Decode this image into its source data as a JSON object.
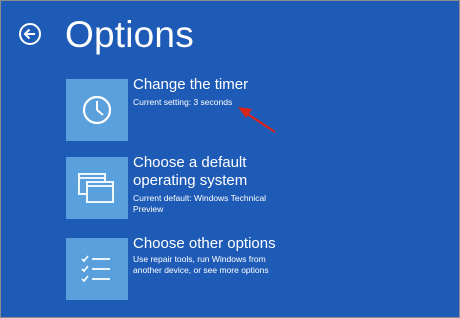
{
  "page": {
    "title": "Options",
    "back_icon": "back-arrow-icon"
  },
  "options": [
    {
      "title": "Change the timer",
      "subtitle": "Current setting: 3 seconds",
      "icon": "clock-icon"
    },
    {
      "title": "Choose a default operating system",
      "subtitle": "Current default: Windows Technical Preview",
      "icon": "windows-stack-icon"
    },
    {
      "title": "Choose other options",
      "subtitle": "Use repair tools, run Windows from another device, or see more options",
      "icon": "checklist-icon"
    }
  ],
  "colors": {
    "background": "#1e5bb7",
    "tile": "#5aa0dd",
    "annotation_arrow": "#d9261c"
  }
}
